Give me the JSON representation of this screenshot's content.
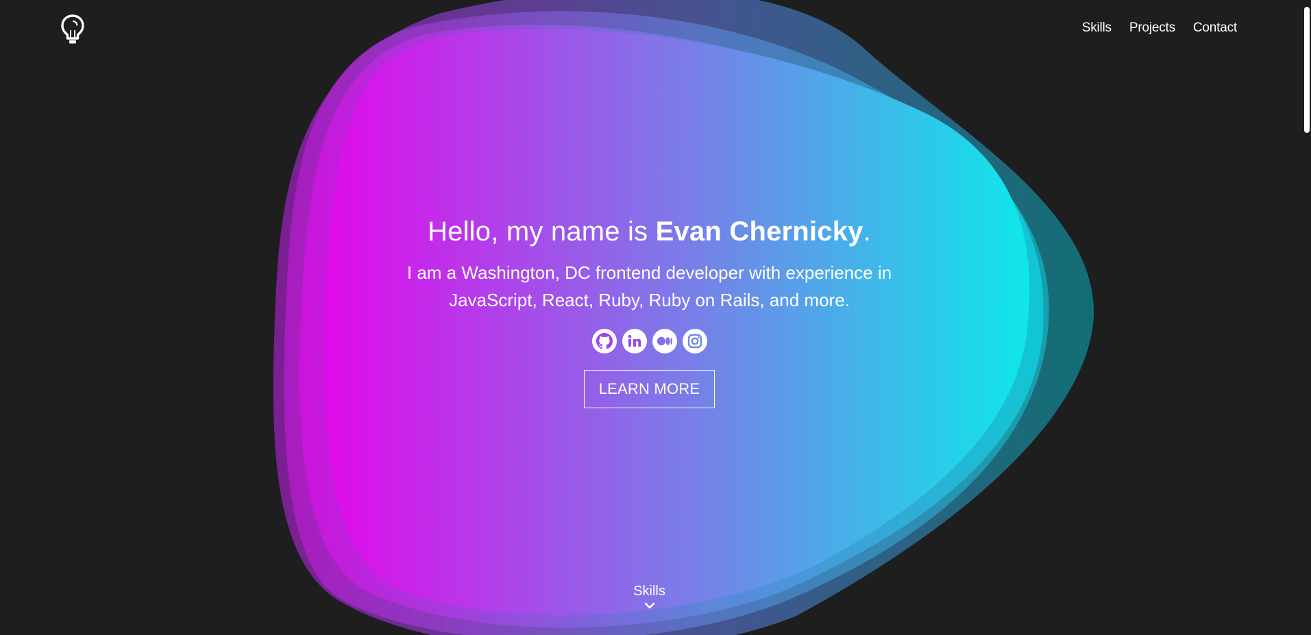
{
  "header": {
    "logo_icon": "lightbulb-icon",
    "nav": [
      {
        "label": "Skills"
      },
      {
        "label": "Projects"
      },
      {
        "label": "Contact"
      }
    ]
  },
  "hero": {
    "greeting": "Hello, my name is ",
    "name": "Evan Chernicky",
    "greeting_end": ".",
    "bio": "I am a Washington, DC frontend developer with experience in JavaScript, React, Ruby, Ruby on Rails, and more.",
    "socials": [
      {
        "icon": "github-icon"
      },
      {
        "icon": "linkedin-icon"
      },
      {
        "icon": "medium-icon"
      },
      {
        "icon": "instagram-icon"
      }
    ],
    "button_label": "LEARN MORE"
  },
  "scroll_cue": {
    "label": "Skills",
    "icon": "chevron-down-icon"
  },
  "colors": {
    "background": "#1e1e1e",
    "gradient_start": "#e10aea",
    "gradient_end": "#0ee8ea"
  }
}
